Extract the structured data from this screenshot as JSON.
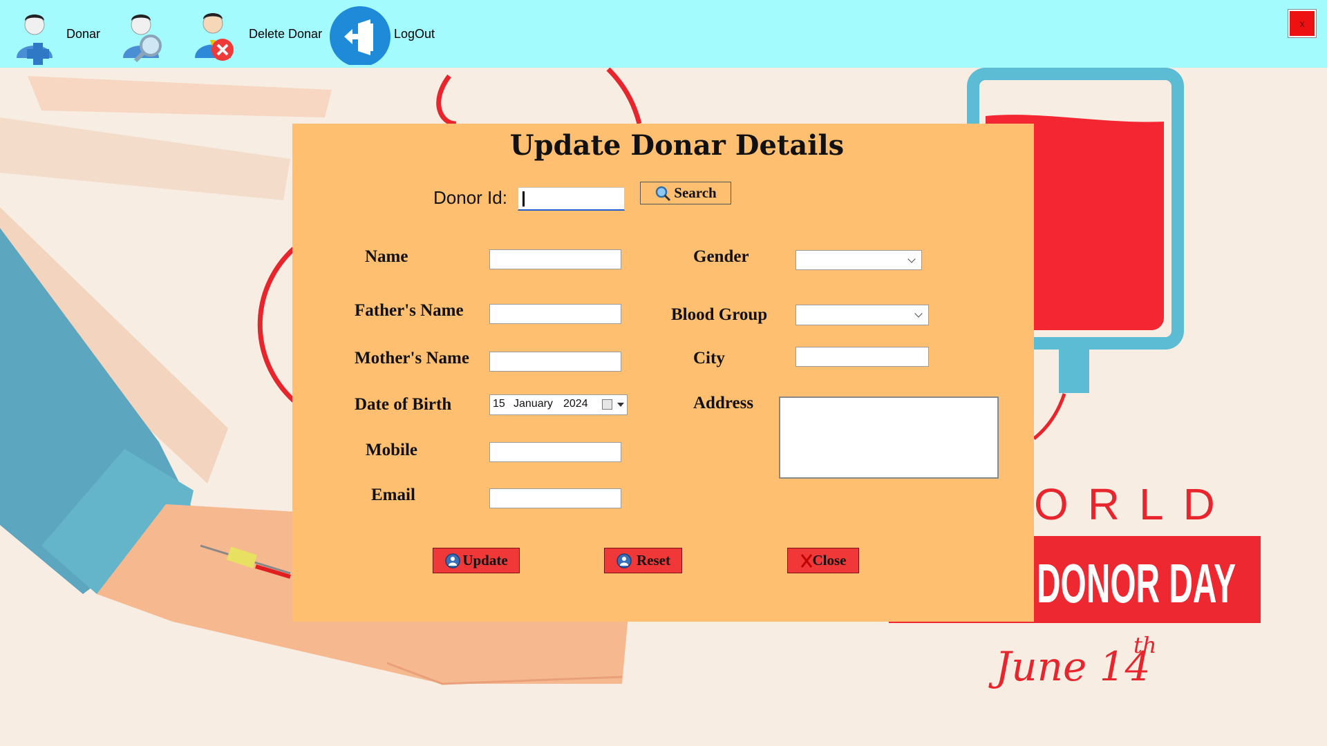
{
  "toolbar": {
    "items": [
      {
        "label": "Donar",
        "icon": "add-donor-icon"
      },
      {
        "label": "",
        "icon": "search-donor-icon"
      },
      {
        "label": "Delete Donar",
        "icon": "delete-donor-icon"
      },
      {
        "label": "LogOut",
        "icon": "logout-icon"
      }
    ],
    "close_label": "x"
  },
  "background": {
    "world_text": "ORLD",
    "banner_text": "DONOR DAY",
    "date_main": "June 14",
    "date_suffix": "th"
  },
  "form": {
    "title": "Update Donar Details",
    "donor_id_label": "Donor Id:",
    "donor_id_value": "",
    "search_label": "Search",
    "name_label": "Name",
    "fathers_name_label": "Father's Name",
    "mothers_name_label": "Mother's Name",
    "dob_label": "Date of Birth",
    "dob": {
      "day": "15",
      "month": "January",
      "year": "2024"
    },
    "mobile_label": "Mobile",
    "email_label": "Email",
    "gender_label": "Gender",
    "blood_group_label": "Blood Group",
    "city_label": "City",
    "address_label": "Address",
    "update_label": "Update",
    "reset_label": "Reset",
    "close_label": "Close"
  },
  "colors": {
    "toolbar_bg": "#a3fbfe",
    "panel_bg": "#ffbf70",
    "button_red": "#f13838",
    "banner_red": "#ee2831"
  }
}
